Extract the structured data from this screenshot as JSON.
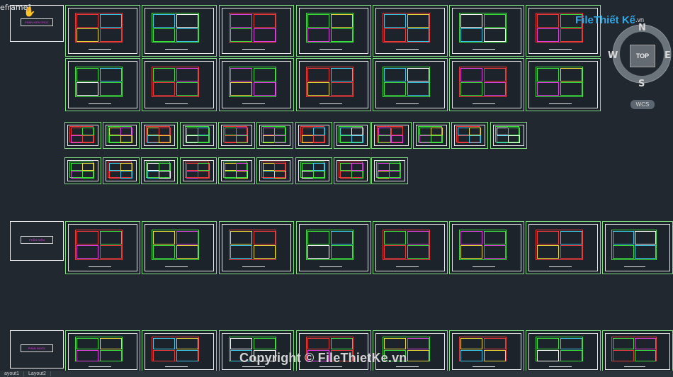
{
  "viewport": {
    "label": "eframe]"
  },
  "title_blocks": [
    {
      "name": "title-block-architecture",
      "text": "PHẦN KIẾN TRÚC"
    },
    {
      "name": "title-block-electrical",
      "text": "PHẦN ĐIỆN"
    },
    {
      "name": "title-block-plumbing",
      "text": "PHẦN NƯỚC"
    }
  ],
  "navigation": {
    "view_label": "TOP",
    "north": "N",
    "south": "S",
    "east": "E",
    "west": "W",
    "ucs_label": "WCS"
  },
  "watermark": {
    "logo_part1": "File",
    "logo_part2": "Thiết Kế",
    "logo_part3": ".vn",
    "copyright": "Copyright © FileThietKe.vn"
  },
  "layout_tabs": [
    "ayout1",
    "Layout2"
  ],
  "colors": {
    "background": "#212830",
    "sheet_border": "#7fdc7f",
    "paper_border": "#e8e8e8",
    "accent_red": "#e83a3a",
    "accent_green": "#3ddc3d",
    "accent_cyan": "#3ac8e8",
    "accent_magenta": "#e040e0",
    "accent_yellow": "#e8d83a"
  }
}
